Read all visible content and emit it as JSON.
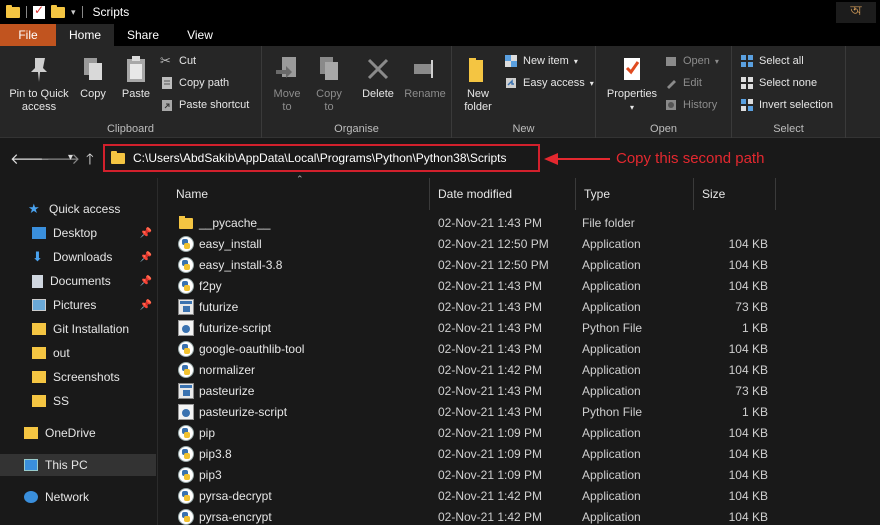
{
  "window": {
    "title": "Scripts",
    "lang_indicator": "অ"
  },
  "tabs": [
    {
      "label": "File"
    },
    {
      "label": "Home"
    },
    {
      "label": "Share"
    },
    {
      "label": "View"
    }
  ],
  "ribbon": {
    "clipboard": {
      "label": "Clipboard",
      "pin_line1": "Pin to Quick",
      "pin_line2": "access",
      "copy": "Copy",
      "paste": "Paste",
      "cut": "Cut",
      "copy_path": "Copy path",
      "paste_shortcut": "Paste shortcut"
    },
    "organise": {
      "label": "Organise",
      "move_line1": "Move",
      "move_line2": "to",
      "copy_line1": "Copy",
      "copy_line2": "to",
      "delete": "Delete",
      "rename": "Rename"
    },
    "new": {
      "label": "New",
      "folder_line1": "New",
      "folder_line2": "folder",
      "new_item": "New item",
      "easy_access": "Easy access"
    },
    "open": {
      "label": "Open",
      "properties": "Properties",
      "open": "Open",
      "edit": "Edit",
      "history": "History"
    },
    "select": {
      "label": "Select",
      "select_all": "Select all",
      "select_none": "Select none",
      "invert": "Invert selection"
    }
  },
  "address": {
    "path": "C:\\Users\\AbdSakib\\AppData\\Local\\Programs\\Python\\Python38\\Scripts",
    "annotation": "Copy this second path",
    "annotation_color": "#e3282f"
  },
  "sidebar": {
    "items": [
      {
        "label": "Quick access"
      },
      {
        "label": "Desktop"
      },
      {
        "label": "Downloads"
      },
      {
        "label": "Documents"
      },
      {
        "label": "Pictures"
      },
      {
        "label": "Git Installation"
      },
      {
        "label": "out"
      },
      {
        "label": "Screenshots"
      },
      {
        "label": "SS"
      },
      {
        "label": "OneDrive"
      },
      {
        "label": "This PC"
      },
      {
        "label": "Network"
      }
    ]
  },
  "columns": {
    "name": "Name",
    "date": "Date modified",
    "type": "Type",
    "size": "Size"
  },
  "files": [
    {
      "name": "__pycache__",
      "date": "02-Nov-21 1:43 PM",
      "type": "File folder",
      "size": "",
      "icon": "folder"
    },
    {
      "name": "easy_install",
      "date": "02-Nov-21 12:50 PM",
      "type": "Application",
      "size": "104 KB",
      "icon": "python-exe"
    },
    {
      "name": "easy_install-3.8",
      "date": "02-Nov-21 12:50 PM",
      "type": "Application",
      "size": "104 KB",
      "icon": "python-exe"
    },
    {
      "name": "f2py",
      "date": "02-Nov-21 1:43 PM",
      "type": "Application",
      "size": "104 KB",
      "icon": "python-exe"
    },
    {
      "name": "futurize",
      "date": "02-Nov-21 1:43 PM",
      "type": "Application",
      "size": "73 KB",
      "icon": "exe"
    },
    {
      "name": "futurize-script",
      "date": "02-Nov-21 1:43 PM",
      "type": "Python File",
      "size": "1 KB",
      "icon": "script"
    },
    {
      "name": "google-oauthlib-tool",
      "date": "02-Nov-21 1:43 PM",
      "type": "Application",
      "size": "104 KB",
      "icon": "python-exe"
    },
    {
      "name": "normalizer",
      "date": "02-Nov-21 1:42 PM",
      "type": "Application",
      "size": "104 KB",
      "icon": "python-exe"
    },
    {
      "name": "pasteurize",
      "date": "02-Nov-21 1:43 PM",
      "type": "Application",
      "size": "73 KB",
      "icon": "exe"
    },
    {
      "name": "pasteurize-script",
      "date": "02-Nov-21 1:43 PM",
      "type": "Python File",
      "size": "1 KB",
      "icon": "script"
    },
    {
      "name": "pip",
      "date": "02-Nov-21 1:09 PM",
      "type": "Application",
      "size": "104 KB",
      "icon": "python-exe"
    },
    {
      "name": "pip3.8",
      "date": "02-Nov-21 1:09 PM",
      "type": "Application",
      "size": "104 KB",
      "icon": "python-exe"
    },
    {
      "name": "pip3",
      "date": "02-Nov-21 1:09 PM",
      "type": "Application",
      "size": "104 KB",
      "icon": "python-exe"
    },
    {
      "name": "pyrsa-decrypt",
      "date": "02-Nov-21 1:42 PM",
      "type": "Application",
      "size": "104 KB",
      "icon": "python-exe"
    },
    {
      "name": "pyrsa-encrypt",
      "date": "02-Nov-21 1:42 PM",
      "type": "Application",
      "size": "104 KB",
      "icon": "python-exe"
    }
  ]
}
